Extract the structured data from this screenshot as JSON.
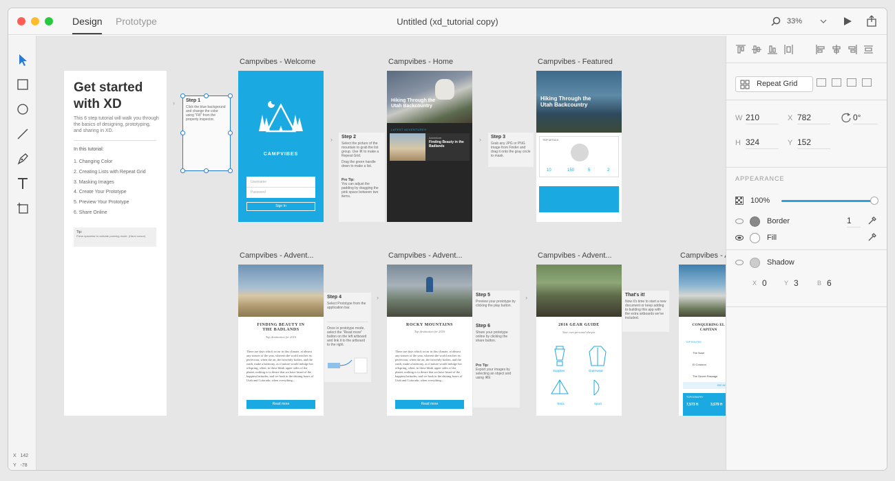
{
  "window": {
    "title": "Untitled (xd_tutorial copy)",
    "tabs": [
      {
        "label": "Design"
      },
      {
        "label": "Prototype"
      }
    ],
    "zoom": "33%"
  },
  "status": {
    "x_label": "X",
    "x_value": "142",
    "y_label": "Y",
    "y_value": "-78"
  },
  "intro": {
    "title": "Get started with XD",
    "desc": "This 6 step tutorial will walk you through the basics of designing, prototyping, and sharing in XD.",
    "in_this": "In this tutorial:",
    "items": [
      "1. Changing Color",
      "2. Creating Lists with Repeat Grid",
      "3. Masking Images",
      "4. Create Your Prototype",
      "5. Preview Your Prototype",
      "6. Share Online"
    ],
    "tip_title": "Tip:",
    "tip_text": "Press spacebar to activate panning mode. (Hand cursor)"
  },
  "artboards": {
    "welcome": {
      "title": "Campvibes - Welcome",
      "brand": "CAMPVIBES",
      "username": "Username",
      "password": "Password",
      "signin": "Sign In"
    },
    "home": {
      "title": "Campvibes - Home",
      "headline": "Hiking Through the Utah Backcountry",
      "latest": "LATEST ADVENTURES",
      "card_kicker": "Adventure",
      "card_title": "Finding Beauty in the Badlands"
    },
    "featured": {
      "title": "Campvibes - Featured",
      "headline": "Hiking Through the Utah Backcountry",
      "trip": "TRIP DETAILS",
      "stats": [
        "10",
        "150",
        "5",
        "2"
      ]
    },
    "adv1": {
      "title": "Campvibes - Advent...",
      "heading": "FINDING BEAUTY IN THE BADLANDS",
      "sub": "Top destination for 2016",
      "body": "There are days which occur in this climate, at almost any season of the year, wherein the world reaches its perfection, when the air, the heavenly bodies, and the earth, make a harmony, as if nature would indulge her offspring; when, in these bleak upper sides of the planet, nothing is to desire that we have heard of the happiest latitudes, and we bask in the shining hours of Utah and Colorado; when everything...",
      "button": "Read more"
    },
    "adv2": {
      "title": "Campvibes - Advent...",
      "heading": "ROCKY MOUNTAINS",
      "sub": "Top destination for 2016",
      "body": "There are days which occur in this climate, at almost any season of the year, wherein the world reaches its perfection, when the air, the heavenly bodies, and the earth, make a harmony, as if nature would indulge her offspring; when, in these bleak upper sides of the planet, nothing is to desire that we have heard of the happiest latitudes, and we bask in the shining hours of Utah and Colorado; when everything...",
      "button": "Read more"
    },
    "adv3": {
      "title": "Campvibes - Advent...",
      "heading": "2016 GEAR GUIDE",
      "sub": "Your own personal sherpa.",
      "gear": [
        "Supplies",
        "Outerwear",
        "Tents",
        "Sport"
      ]
    },
    "adv4": {
      "title": "Campvibes - A",
      "heading": "CONQUERING EL CAPITAN",
      "routes_h": "TOP ROUTES",
      "routes": [
        "The Nose",
        "El Corazon",
        "The Secret Passage"
      ],
      "see_more": "SEE MORE",
      "topo": "TOPOGRAPHY",
      "elev": [
        "7,573 ft",
        "3,579 ft"
      ]
    }
  },
  "steps": {
    "s1": {
      "title": "Step 1",
      "text": "Click the blue background and change the color using \"Fill\" from the property inspector."
    },
    "s2": {
      "title": "Step 2",
      "text": "Select the picture of the mountain to grab the list group. Use ⌘ to make a Repeat Grid.",
      "text2": "Drag the green handle down to make a list.",
      "tip_h": "Pro Tip:",
      "tip": "You can adjust the padding by dragging the pink space between two items."
    },
    "s3": {
      "title": "Step 3",
      "text": "Grab any JPG or PNG image from Finder and drag it onto the gray circle to mask."
    },
    "s4": {
      "title": "Step 4",
      "text": "Select Prototype from the application bar.",
      "text2": "Once in prototype mode, select the \"Read more\" button on the left artboard and link it to the artboard to the right."
    },
    "s5": {
      "title": "Step 5",
      "text": "Preview your prototype by clicking the play button."
    },
    "s6": {
      "title": "Step 6",
      "text": "Share your prototype online by clicking the share button.",
      "tip_h": "Pro Tip:",
      "tip": "Export your images by selecting an object and using ⌘E"
    },
    "done": {
      "title": "That's it!",
      "text": "Now it's time to start a new document or keep adding to building this app with the extra artboards we've included."
    }
  },
  "inspector": {
    "repeat_grid": "Repeat Grid",
    "w_label": "W",
    "w": "210",
    "x_label": "X",
    "x": "782",
    "h_label": "H",
    "h": "324",
    "y_label": "Y",
    "y": "152",
    "rotation": "0°",
    "appearance": "APPEARANCE",
    "opacity": "100%",
    "opacity_fraction": 1.0,
    "border": "Border",
    "border_width": "1",
    "fill": "Fill",
    "shadow": "Shadow",
    "sx_label": "X",
    "sx": "0",
    "sy_label": "Y",
    "sy": "3",
    "sb_label": "B",
    "sb": "6"
  },
  "colors": {
    "accent": "#2a9fd8",
    "blue": "#1aa9e0",
    "selection": "#2a7bd4"
  }
}
